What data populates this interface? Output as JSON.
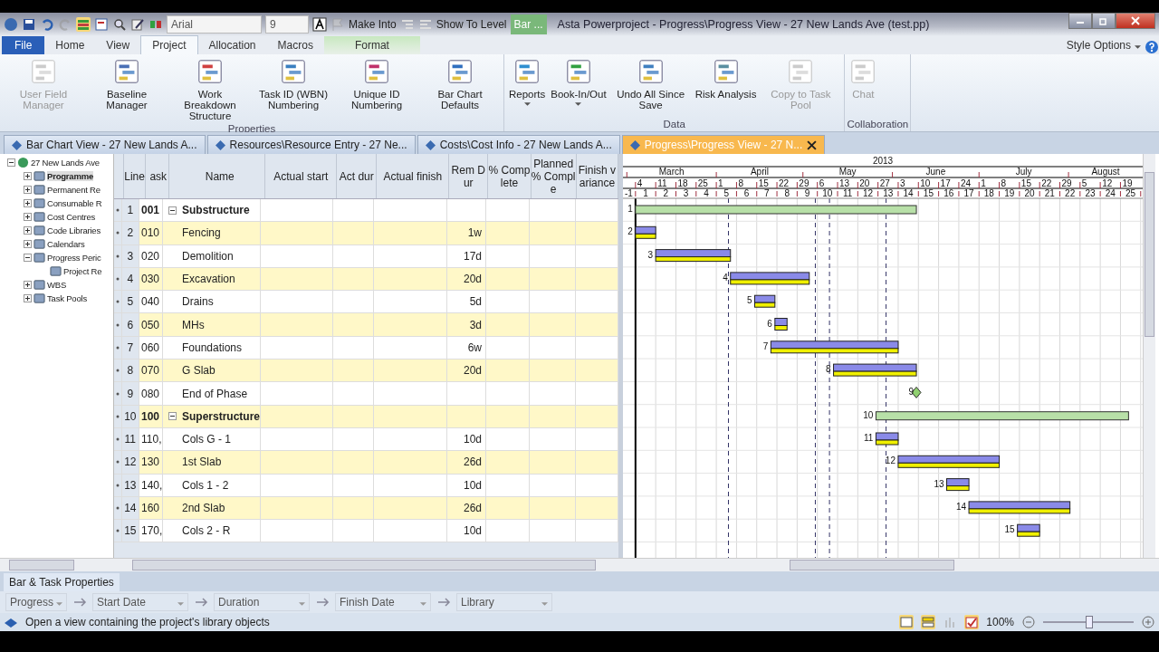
{
  "title_bar": {
    "font": "Arial",
    "font_size": "9",
    "make_into": "Make Into",
    "show_to_level": "Show To Level",
    "context_tab": "Bar ...",
    "title": "Asta Powerproject - Progress\\Progress View - 27 New Lands Ave (test.pp)"
  },
  "ribbon_tabs": [
    {
      "label": "File",
      "kind": "file",
      "selected": false
    },
    {
      "label": "Home",
      "kind": "tab",
      "selected": false
    },
    {
      "label": "View",
      "kind": "tab",
      "selected": false
    },
    {
      "label": "Project",
      "kind": "tab",
      "selected": true
    },
    {
      "label": "Allocation",
      "kind": "tab",
      "selected": false
    },
    {
      "label": "Macros",
      "kind": "tab",
      "selected": false
    },
    {
      "label": "Format",
      "kind": "context",
      "selected": false
    }
  ],
  "style_options": "Style Options",
  "ribbon_groups": [
    {
      "label": "Properties",
      "buttons": [
        {
          "label": "User Field Manager",
          "disabled": true,
          "dropdown": false
        },
        {
          "label": "Baseline Manager",
          "disabled": false,
          "dropdown": false
        },
        {
          "label": "Work Breakdown Structure",
          "disabled": false,
          "dropdown": false
        },
        {
          "label": "Task ID (WBN) Numbering",
          "disabled": false,
          "dropdown": false
        },
        {
          "label": "Unique ID Numbering",
          "disabled": false,
          "dropdown": false
        },
        {
          "label": "Bar Chart Defaults",
          "disabled": false,
          "dropdown": false
        }
      ]
    },
    {
      "label": "Data",
      "buttons": [
        {
          "label": "Reports",
          "disabled": false,
          "dropdown": true
        },
        {
          "label": "Book-In/Out",
          "disabled": false,
          "dropdown": true
        },
        {
          "label": "Undo All Since Save",
          "disabled": false,
          "dropdown": false
        },
        {
          "label": "Risk Analysis",
          "disabled": false,
          "dropdown": false
        },
        {
          "label": "Copy to Task Pool",
          "disabled": true,
          "dropdown": false
        }
      ]
    },
    {
      "label": "Collaboration",
      "buttons": [
        {
          "label": "Chat",
          "disabled": true,
          "dropdown": false
        }
      ]
    }
  ],
  "doc_tabs": [
    {
      "label": "Bar Chart View - 27 New Lands A...",
      "selected": false
    },
    {
      "label": "Resources\\Resource Entry - 27 Ne...",
      "selected": false
    },
    {
      "label": "Costs\\Cost Info - 27 New Lands A...",
      "selected": false
    },
    {
      "label": "Progress\\Progress View - 27 N...",
      "selected": true
    }
  ],
  "tree": [
    {
      "label": "27 New Lands Ave",
      "expanded": true,
      "selected": false,
      "children": [
        {
          "label": "Programme",
          "expanded": false,
          "selected": true
        },
        {
          "label": "Permanent Re",
          "expanded": false,
          "selected": false
        },
        {
          "label": "Consumable R",
          "expanded": false,
          "selected": false
        },
        {
          "label": "Cost Centres",
          "expanded": false,
          "selected": false
        },
        {
          "label": "Code Libraries",
          "expanded": false,
          "selected": false
        },
        {
          "label": "Calendars",
          "expanded": false,
          "selected": false
        },
        {
          "label": "Progress Peric",
          "expanded": true,
          "selected": false,
          "children": [
            {
              "label": "Project Re",
              "selected": false
            }
          ]
        },
        {
          "label": "WBS",
          "expanded": false,
          "selected": false
        },
        {
          "label": "Task Pools",
          "expanded": false,
          "selected": false
        }
      ]
    }
  ],
  "table": {
    "columns": [
      "Line",
      "ask",
      "Name",
      "Actual start",
      "Act dur",
      "Actual finish",
      "Rem Dur",
      "% Complete",
      "Planned % Comple",
      "Finish variance"
    ],
    "rows": [
      {
        "line": "1",
        "id": "001",
        "name": "Substructure",
        "rem_dur": "",
        "kind": "summary",
        "expanded": true,
        "bar_label": "1"
      },
      {
        "line": "2",
        "id": "010",
        "name": "Fencing",
        "rem_dur": "1w",
        "kind": "task",
        "bar_label": "2"
      },
      {
        "line": "3",
        "id": "020",
        "name": "Demolition",
        "rem_dur": "17d",
        "kind": "task",
        "bar_label": "3"
      },
      {
        "line": "4",
        "id": "030",
        "name": "Excavation",
        "rem_dur": "20d",
        "kind": "task",
        "bar_label": "4"
      },
      {
        "line": "5",
        "id": "040",
        "name": "Drains",
        "rem_dur": "5d",
        "kind": "task",
        "bar_label": "5"
      },
      {
        "line": "6",
        "id": "050",
        "name": "MHs",
        "rem_dur": "3d",
        "kind": "task",
        "bar_label": "6"
      },
      {
        "line": "7",
        "id": "060",
        "name": "Foundations",
        "rem_dur": "6w",
        "kind": "task",
        "bar_label": "7"
      },
      {
        "line": "8",
        "id": "070",
        "name": "G Slab",
        "rem_dur": "20d",
        "kind": "task",
        "bar_label": "8"
      },
      {
        "line": "9",
        "id": "080",
        "name": "End of Phase",
        "rem_dur": "",
        "kind": "milestone",
        "bar_label": "9"
      },
      {
        "line": "10",
        "id": "100",
        "name": "Superstructure",
        "rem_dur": "",
        "kind": "summary",
        "expanded": true,
        "bar_label": "10"
      },
      {
        "line": "11",
        "id": "110,",
        "name": "Cols G - 1",
        "rem_dur": "10d",
        "kind": "task",
        "bar_label": "11"
      },
      {
        "line": "12",
        "id": "130",
        "name": "1st Slab",
        "rem_dur": "26d",
        "kind": "task",
        "bar_label": "12"
      },
      {
        "line": "13",
        "id": "140,",
        "name": "Cols 1 - 2",
        "rem_dur": "10d",
        "kind": "task",
        "bar_label": "13"
      },
      {
        "line": "14",
        "id": "160",
        "name": "2nd Slab",
        "rem_dur": "26d",
        "kind": "task",
        "bar_label": "14"
      },
      {
        "line": "15",
        "id": "170,",
        "name": "Cols 2 - R",
        "rem_dur": "10d",
        "kind": "task",
        "bar_label": "15"
      }
    ]
  },
  "gantt": {
    "year": "2013",
    "months": [
      "March",
      "April",
      "May",
      "June",
      "July",
      "August"
    ],
    "dates": [
      "4",
      "11",
      "18",
      "25",
      "1",
      "8",
      "15",
      "22",
      "29",
      "6",
      "13",
      "20",
      "27",
      "3",
      "10",
      "17",
      "24",
      "1",
      "8",
      "15",
      "22",
      "29",
      "5",
      "12",
      "19"
    ],
    "weeks": [
      "-1",
      "1",
      "2",
      "3",
      "4",
      "5",
      "6",
      "7",
      "8",
      "9",
      "10",
      "11",
      "12",
      "13",
      "14",
      "15",
      "16",
      "17",
      "18",
      "19",
      "20",
      "21",
      "22",
      "23",
      "24",
      "25"
    ]
  },
  "bottom_panel": {
    "tab": "Bar & Task Properties",
    "fields": [
      "Progress",
      "Start Date",
      "Duration",
      "Finish Date",
      "Library"
    ]
  },
  "status_bar": {
    "message": "Open a view containing the project's library objects",
    "zoom": "100%",
    "zoom_slider": {
      "level": 0.5
    }
  }
}
